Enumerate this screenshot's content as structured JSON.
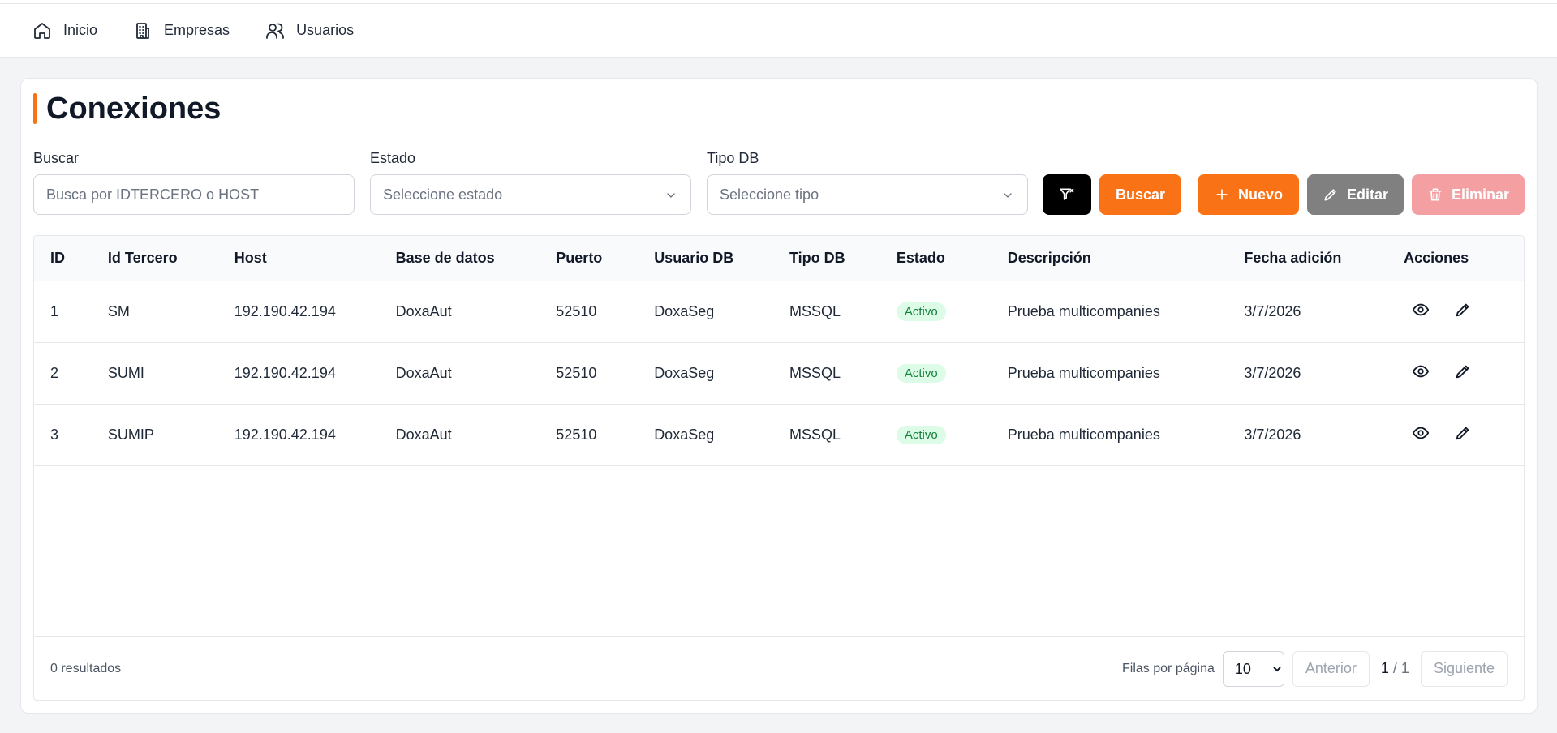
{
  "nav": {
    "items": [
      {
        "label": "Inicio",
        "icon": "home-icon"
      },
      {
        "label": "Empresas",
        "icon": "building-icon"
      },
      {
        "label": "Usuarios",
        "icon": "users-icon"
      }
    ]
  },
  "page": {
    "title": "Conexiones"
  },
  "filters": {
    "search_label": "Buscar",
    "search_placeholder": "Busca por IDTERCERO o HOST",
    "estado_label": "Estado",
    "estado_placeholder": "Seleccione estado",
    "tipo_label": "Tipo DB",
    "tipo_placeholder": "Seleccione tipo"
  },
  "toolbar": {
    "buscar_label": "Buscar",
    "nuevo_label": "Nuevo",
    "editar_label": "Editar",
    "eliminar_label": "Eliminar"
  },
  "table": {
    "columns": [
      "ID",
      "Id Tercero",
      "Host",
      "Base de datos",
      "Puerto",
      "Usuario DB",
      "Tipo DB",
      "Estado",
      "Descripción",
      "Fecha adición",
      "Acciones"
    ],
    "rows": [
      {
        "id": "1",
        "tercero": "SM",
        "host": "192.190.42.194",
        "db": "DoxaAut",
        "puerto": "52510",
        "usuario": "DoxaSeg",
        "tipo": "MSSQL",
        "estado": "Activo",
        "descripcion": "Prueba multicompanies",
        "fecha": "3/7/2026"
      },
      {
        "id": "2",
        "tercero": "SUMI",
        "host": "192.190.42.194",
        "db": "DoxaAut",
        "puerto": "52510",
        "usuario": "DoxaSeg",
        "tipo": "MSSQL",
        "estado": "Activo",
        "descripcion": "Prueba multicompanies",
        "fecha": "3/7/2026"
      },
      {
        "id": "3",
        "tercero": "SUMIP",
        "host": "192.190.42.194",
        "db": "DoxaAut",
        "puerto": "52510",
        "usuario": "DoxaSeg",
        "tipo": "MSSQL",
        "estado": "Activo",
        "descripcion": "Prueba multicompanies",
        "fecha": "3/7/2026"
      }
    ]
  },
  "footer": {
    "results": "0 resultados",
    "rows_per_page_label": "Filas por página",
    "rows_per_page": "10",
    "prev_label": "Anterior",
    "page_current": "1",
    "page_total": "/ 1",
    "next_label": "Siguiente"
  },
  "colors": {
    "accent": "#f97316",
    "delete": "#f4a0a3",
    "edit": "#808080",
    "badge_bg": "#dcfce7",
    "badge_text": "#15803d"
  }
}
